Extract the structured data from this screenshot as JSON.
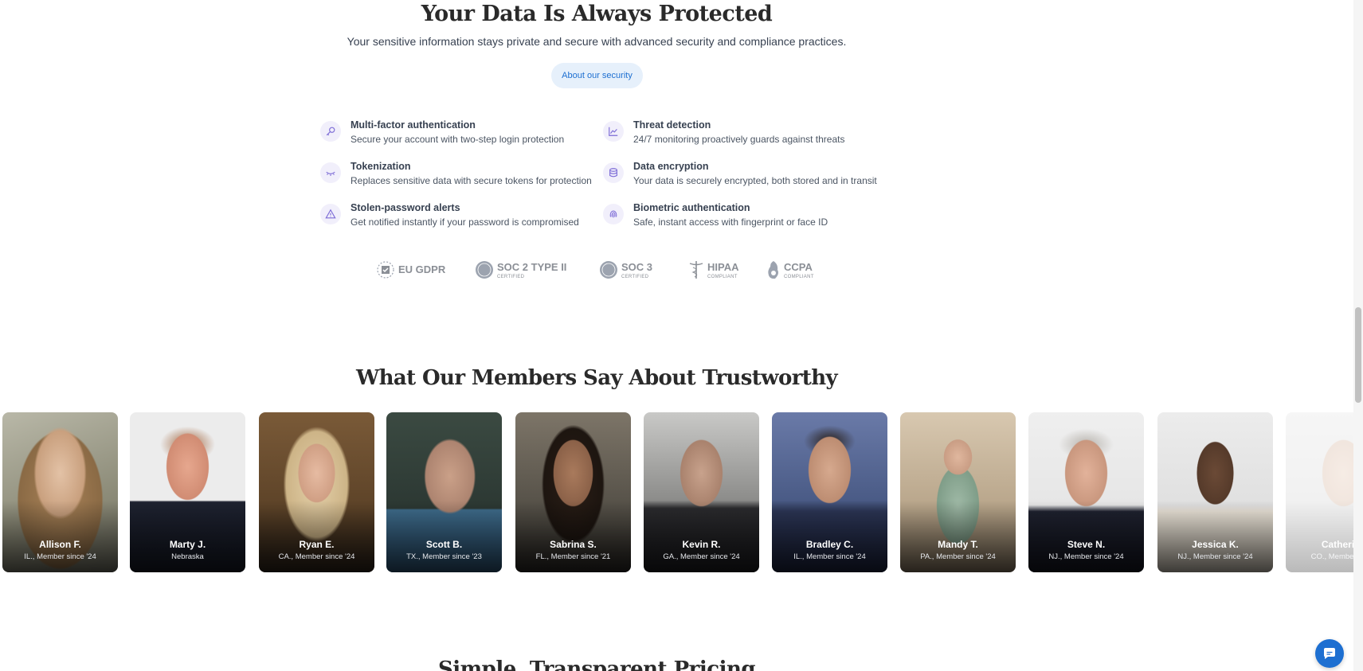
{
  "security": {
    "title": "Your Data Is Always Protected",
    "subtitle": "Your sensitive information stays private and secure with advanced security and compliance practices.",
    "button_label": "About our security",
    "features": [
      {
        "icon": "key-icon",
        "title": "Multi-factor authentication",
        "desc": "Secure your account with two-step login protection"
      },
      {
        "icon": "chart-line-icon",
        "title": "Threat detection",
        "desc": "24/7 monitoring proactively guards against threats"
      },
      {
        "icon": "eye-closed-icon",
        "title": "Tokenization",
        "desc": "Replaces sensitive data with secure tokens for protection"
      },
      {
        "icon": "database-icon",
        "title": "Data encryption",
        "desc": "Your data is securely encrypted, both stored and in transit"
      },
      {
        "icon": "warning-triangle-icon",
        "title": "Stolen-password alerts",
        "desc": "Get notified instantly if your password is compromised"
      },
      {
        "icon": "fingerprint-icon",
        "title": "Biometric authentication",
        "desc": "Safe, instant access with fingerprint or face ID"
      }
    ],
    "badges": [
      {
        "name": "EU GDPR",
        "small": ""
      },
      {
        "name": "SOC 2 TYPE II",
        "small": "CERTIFIED"
      },
      {
        "name": "SOC 3",
        "small": "CERTIFIED"
      },
      {
        "name": "HIPAA",
        "small": "COMPLIANT"
      },
      {
        "name": "CCPA",
        "small": "COMPLIANT"
      }
    ]
  },
  "testimonials": {
    "title": "What Our Members Say About Trustworthy",
    "members": [
      {
        "name": "Allison F.",
        "meta": "IL., Member since '24"
      },
      {
        "name": "Marty J.",
        "meta": "Nebraska"
      },
      {
        "name": "Ryan E.",
        "meta": "CA., Member since '24"
      },
      {
        "name": "Scott B.",
        "meta": "TX., Member since '23"
      },
      {
        "name": "Sabrina S.",
        "meta": "FL., Member since '21"
      },
      {
        "name": "Kevin R.",
        "meta": "GA., Member since '24"
      },
      {
        "name": "Bradley C.",
        "meta": "IL., Member since '24"
      },
      {
        "name": "Mandy T.",
        "meta": "PA., Member since '24"
      },
      {
        "name": "Steve N.",
        "meta": "NJ., Member since '24"
      },
      {
        "name": "Jessica K.",
        "meta": "NJ., Member since '24"
      },
      {
        "name": "Catherine",
        "meta": "CO., Member since"
      }
    ]
  },
  "pricing": {
    "title": "Simple, Transparent Pricing"
  },
  "colors": {
    "accent": "#1d6fd1",
    "icon_tint": "#7c6bd6"
  }
}
